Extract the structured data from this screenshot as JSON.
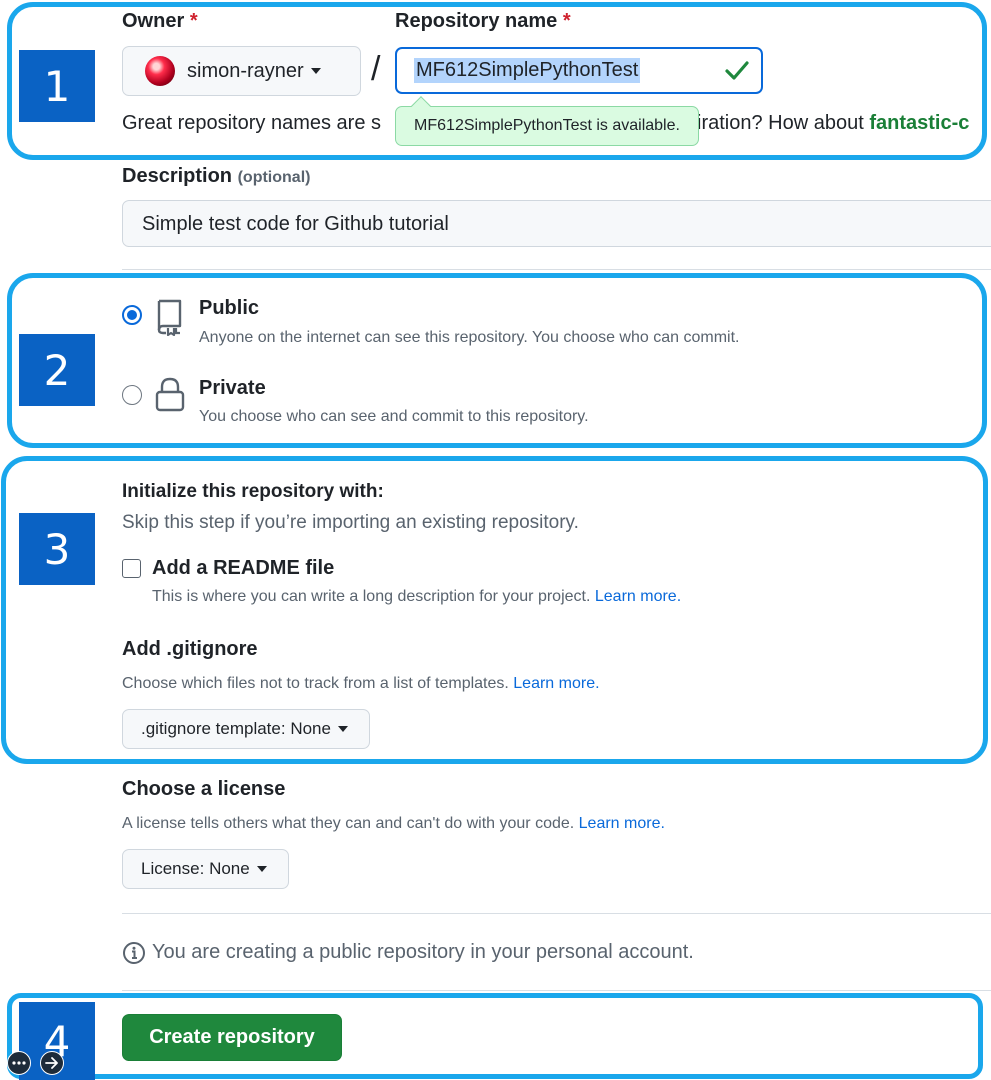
{
  "callouts": [
    "1",
    "2",
    "3",
    "4"
  ],
  "owner": {
    "label": "Owner",
    "required_mark": "*",
    "value": "simon-rayner"
  },
  "repo": {
    "label": "Repository name",
    "required_mark": "*",
    "separator": "/",
    "value": "MF612SimplePythonTest",
    "available_tooltip": "MF612SimplePythonTest is available.",
    "hint_start": "Great repository names are s",
    "hint_end": "iration? How about ",
    "suggestion": "fantastic-c"
  },
  "description": {
    "label": "Description",
    "optional": "(optional)",
    "value": "Simple test code for Github tutorial"
  },
  "visibility": {
    "public": {
      "title": "Public",
      "desc": "Anyone on the internet can see this repository. You choose who can commit.",
      "checked": true
    },
    "private": {
      "title": "Private",
      "desc": "You choose who can see and commit to this repository.",
      "checked": false
    }
  },
  "init": {
    "title": "Initialize this repository with:",
    "subtitle": "Skip this step if you’re importing an existing repository.",
    "readme_label": "Add a README file",
    "readme_desc": "This is where you can write a long description for your project.",
    "learn_more": "Learn more."
  },
  "gitignore": {
    "title": "Add .gitignore",
    "desc": "Choose which files not to track from a list of templates.",
    "learn_more": "Learn more.",
    "button_prefix": ".gitignore template:",
    "button_value": "None"
  },
  "license": {
    "title": "Choose a license",
    "desc": "A license tells others what they can and can't do with your code.",
    "learn_more": "Learn more.",
    "button_prefix": "License:",
    "button_value": "None"
  },
  "notice": "You are creating a public repository in your personal account.",
  "create_button": "Create repository",
  "colors": {
    "accent": "#0969da",
    "success": "#1f883d",
    "callout": "#1aa7ec",
    "step": "#0a62c4"
  }
}
